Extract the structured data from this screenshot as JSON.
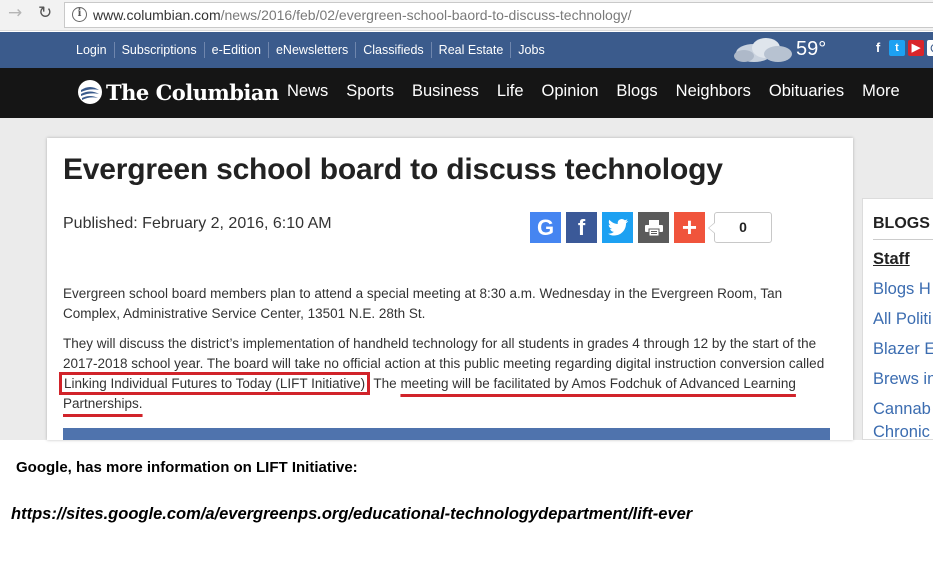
{
  "browser": {
    "url_domain": "www.columbian.com",
    "url_path": "/news/2016/feb/02/evergreen-school-baord-to-discuss-technology/",
    "back_icon": "arrow-left-icon",
    "reload_icon": "reload-icon",
    "info_icon": "info-icon",
    "info_glyph": "i"
  },
  "topbar": {
    "links": [
      "Login",
      "Subscriptions",
      "e-Edition",
      "eNewsletters",
      "Classifieds",
      "Real Estate",
      "Jobs"
    ],
    "temperature": "59°",
    "social": {
      "facebook": "f",
      "twitter": "t",
      "youtube": "▶",
      "instagram": "◎"
    }
  },
  "nav": {
    "logo_text": "The Columbian",
    "items": [
      "News",
      "Sports",
      "Business",
      "Life",
      "Opinion",
      "Blogs",
      "Neighbors",
      "Obituaries",
      "More"
    ]
  },
  "article": {
    "headline": "Evergreen school board to discuss technology",
    "published": "Published: February 2, 2016, 6:10 AM",
    "share_count": "0",
    "share_glyphs": {
      "google": "G",
      "facebook": "f",
      "plus": "+"
    },
    "p1": "Evergreen school board members plan to attend a special meeting at 8:30 a.m. Wednesday in the Evergreen Room, Tan Complex, Administrative Service Center, 13501 N.E. 28th St.",
    "p2_before": "They will discuss the district’s implementation of handheld technology for all students in grades 4 through 12 by the start of the 2017-2018 school year. The board will take no official action at this public meeting regarding digital instruction conversion called ",
    "p2_boxed": "Linking Individual Futures to Today (LIFT Initiative)",
    "p2_middle": ". The ",
    "p2_underlined": "meeting will be facilitated by Amos Fodchuk of Advanced Learning Partnerships.",
    "colors": {
      "highlight": "#d1232a",
      "topbar": "#3b5b8c",
      "link": "#3b6cb0"
    }
  },
  "sidebar": {
    "title": "BLOGS",
    "items": [
      "Staff",
      "Blogs H",
      "All Politi",
      "Blazer E",
      "Brews in",
      "Cannab",
      "Chronic"
    ]
  },
  "annotation": {
    "note": "Google, has more information on LIFT Initiative:",
    "url": "https://sites.google.com/a/evergreenps.org/educational-technologydepartment/lift-ever"
  }
}
